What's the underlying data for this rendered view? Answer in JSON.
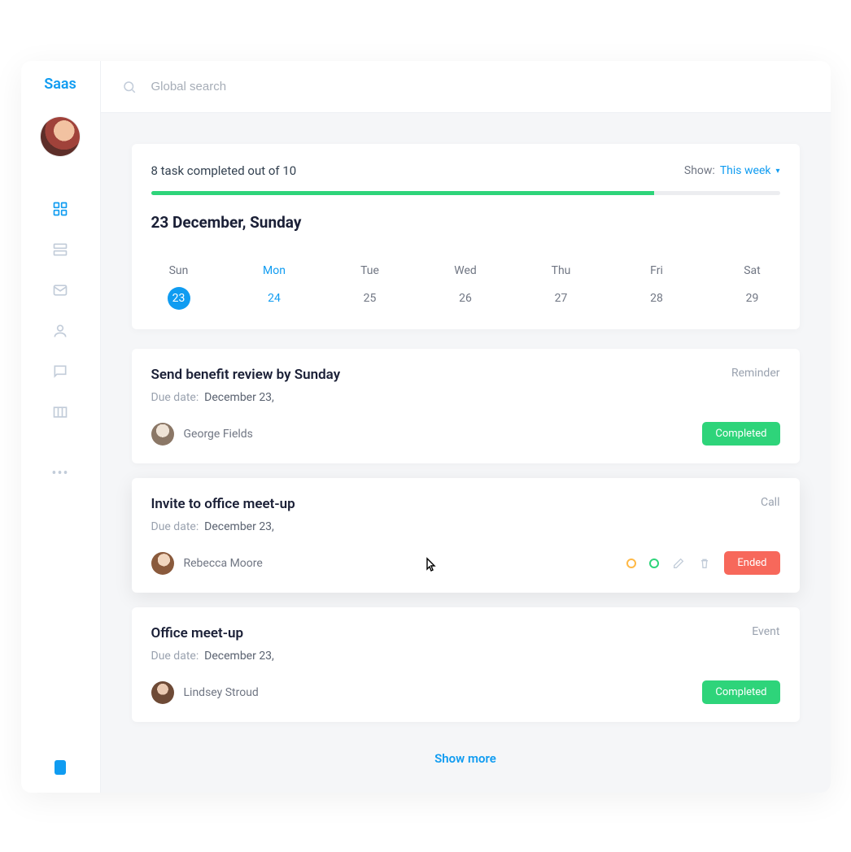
{
  "logo": "Saas",
  "search": {
    "placeholder": "Global search"
  },
  "progress": {
    "text": "8 task completed out of 10",
    "percent": 80,
    "show_label": "Show:",
    "show_value": "This week"
  },
  "date_heading": "23 December, Sunday",
  "week": [
    {
      "label": "Sun",
      "num": "23"
    },
    {
      "label": "Mon",
      "num": "24"
    },
    {
      "label": "Tue",
      "num": "25"
    },
    {
      "label": "Wed",
      "num": "26"
    },
    {
      "label": "Thu",
      "num": "27"
    },
    {
      "label": "Fri",
      "num": "28"
    },
    {
      "label": "Sat",
      "num": "29"
    }
  ],
  "tasks": [
    {
      "title": "Send benefit review by Sunday",
      "tag": "Reminder",
      "due_label": "Due date:",
      "due_value": "December 23,",
      "assignee": "George Fields",
      "status": "Completed"
    },
    {
      "title": "Invite to office meet-up",
      "tag": "Call",
      "due_label": "Due date:",
      "due_value": "December 23,",
      "assignee": "Rebecca Moore",
      "status": "Ended"
    },
    {
      "title": "Office meet-up",
      "tag": "Event",
      "due_label": "Due date:",
      "due_value": "December 23,",
      "assignee": "Lindsey Stroud",
      "status": "Completed"
    }
  ],
  "show_more": "Show more",
  "icons": {
    "dashboard": "dashboard-icon",
    "list": "server-icon",
    "mail": "mail-icon",
    "user": "user-icon",
    "chat": "chat-icon",
    "columns": "columns-icon"
  }
}
